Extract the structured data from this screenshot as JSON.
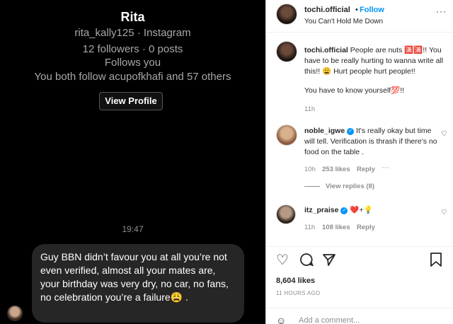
{
  "dm": {
    "name": "Rita",
    "handle": "rita_kally125 · Instagram",
    "stats": "12 followers · 0 posts",
    "follows_you": "Follows you",
    "mutual": "You both follow acupofkhafi and 57 others",
    "view_profile": "View Profile",
    "time": "19:47",
    "message": "Guy BBN didn’t favour you at all you’re not even verified, almost all your mates are, your birthday was very dry, no car, no fans, no celebration you’re a failure😩 ."
  },
  "post": {
    "header": {
      "username": "tochi.official",
      "dot": "•",
      "follow": "Follow",
      "song": "You Can't Hold Me Down",
      "more": "···"
    },
    "caption": {
      "username": "tochi.official",
      "text": "People are nuts 🈵🈵!! You have to be really hurting to wanna write all this!! 😩 Hurt people hurt people!!",
      "text2": "You have to know yourself💯!!",
      "time": "11h"
    },
    "comments": [
      {
        "username": "noble_igwe",
        "text": "It's really okay but time will tell. Verification is thrash if there's no food on the table .",
        "time": "10h",
        "likes": "253 likes",
        "reply": "Reply",
        "more": "···",
        "view_replies": "View replies (8)"
      },
      {
        "username": "itz_praise",
        "text": "❤️+💡",
        "time": "11h",
        "likes": "108 likes",
        "reply": "Reply"
      }
    ],
    "likes": "8,604 likes",
    "ago": "11 HOURS AGO",
    "add_comment_placeholder": "Add a comment..."
  },
  "colors": {
    "accent": "#0095f6",
    "dm_bg": "#000000",
    "bubble": "#262626"
  },
  "icons": [
    "heart-icon",
    "comment-icon",
    "share-icon",
    "bookmark-icon",
    "emoji-icon",
    "verified-icon",
    "more-icon"
  ]
}
